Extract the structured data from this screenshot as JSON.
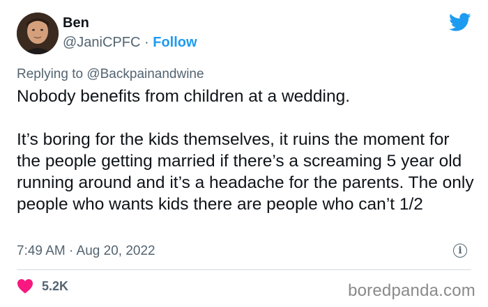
{
  "user": {
    "name": "Ben",
    "handle": "@JaniCPFC",
    "separator": "·",
    "follow_label": "Follow"
  },
  "reply": {
    "prefix": "Replying to",
    "mention": "@Backpainandwine"
  },
  "tweet": {
    "paragraph1": "Nobody benefits from children at a wedding.",
    "paragraph2": "It’s boring for the kids themselves, it ruins the moment for the people getting married if there’s a screaming 5 year old running around and it’s a headache for the parents. The only people who wants kids there are people who can’t 1/2",
    "timestamp": "7:49 AM · Aug 20, 2022"
  },
  "engagement": {
    "likes": "5.2K"
  },
  "watermark": "boredpanda.com",
  "icons": {
    "platform": "twitter-bird-icon",
    "info": "info-icon",
    "like": "heart-icon"
  },
  "colors": {
    "accent": "#1d9bf0",
    "heart": "#f91880",
    "muted": "#536471"
  }
}
